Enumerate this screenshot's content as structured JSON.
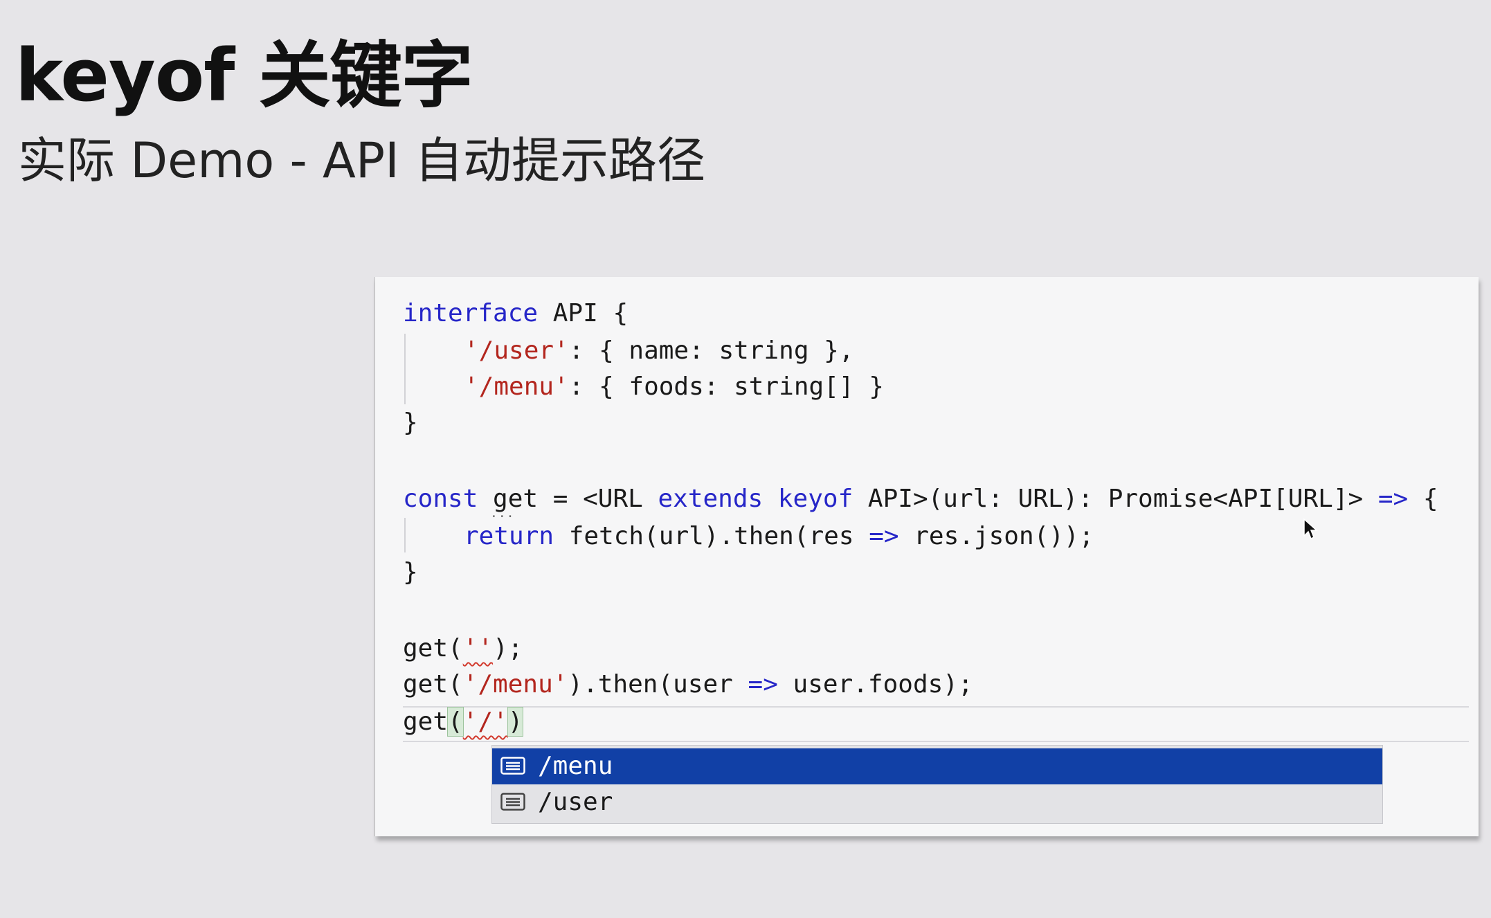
{
  "slide": {
    "title": "keyof 关键字",
    "subtitle": "实际 Demo - API 自动提示路径"
  },
  "code": {
    "l1_kw": "interface",
    "l1_rest": " API {",
    "l2_str": "'/user'",
    "l2_rest": ": { name: string },",
    "l3_str": "'/menu'",
    "l3_rest": ": { foods: string[] }",
    "l4": "}",
    "l6_kw1": "const",
    "l6_a": " get = <URL ",
    "l6_kw2": "extends",
    "l6_sp": " ",
    "l6_kw3": "keyof",
    "l6_b": " API>(url: URL): Promise<API[URL]> ",
    "l6_arrow": "=>",
    "l6_c": " {",
    "l7_kw": "return",
    "l7_a": " fetch(url).then(res ",
    "l7_arrow": "=>",
    "l7_b": " res.json());",
    "l8": "}",
    "l10_a": "get(",
    "l10_str": "''",
    "l10_b": ");",
    "l11_a": "get(",
    "l11_str": "'/menu'",
    "l11_b": ").then(user ",
    "l11_arrow": "=>",
    "l11_c": " user.foods);",
    "l12_a": "get",
    "l12_open": "(",
    "l12_str": "'/'",
    "l12_close": ")"
  },
  "autocomplete": {
    "items": [
      {
        "label": "/menu",
        "icon": "text-entry-icon",
        "selected": true
      },
      {
        "label": "/user",
        "icon": "text-entry-icon",
        "selected": false
      }
    ]
  },
  "colors": {
    "keyword": "#2626c8",
    "string": "#b3261e",
    "selection": "#1140a6"
  }
}
